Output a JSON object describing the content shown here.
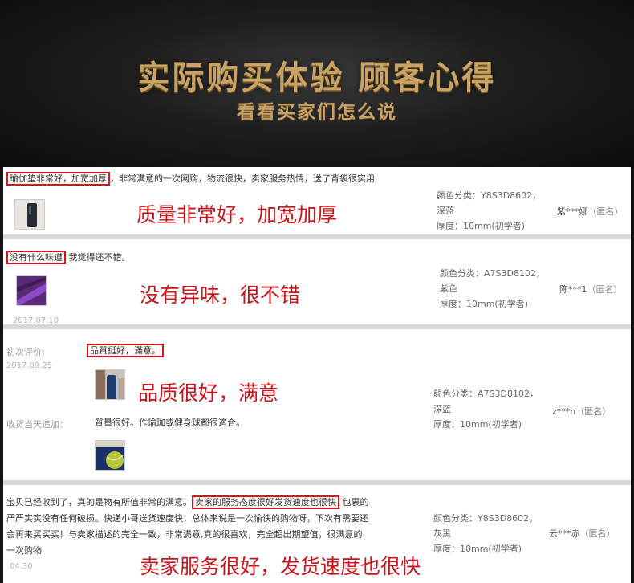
{
  "banner": {
    "title": "实际购买体验 顾客心得",
    "subtitle": "看看买家们怎么说"
  },
  "reviews": [
    {
      "highlight": "瑜伽垫非常好，加宽加厚",
      "rest": "，非常满意的一次网购，物流很快，卖家服务热情，送了背袋很实用",
      "caption": "质量非常好，加宽加厚",
      "meta1": "颜色分类：Y8S3D8602，",
      "meta2": "深蓝",
      "meta3": "厚度：10mm(初学者)",
      "user": "紫***娜",
      "anon": "（匿名）"
    },
    {
      "highlight": "没有什么味道",
      "rest": "我觉得还不错。",
      "caption": "没有异味，很不错",
      "date": "2017.07.10",
      "meta1": "颜色分类：A7S3D8102，",
      "meta2": "紫色",
      "meta3": "厚度：10mm(初学者)",
      "user": "陈***1",
      "anon": "（匿名）"
    },
    {
      "first_label": "初次评价:",
      "first_date": "2017.09.25",
      "highlight": "品質挺好，滿意。",
      "caption": "品质很好，满意",
      "followup_label": "收货当天追加：",
      "followup_text": "質量很好。作瑜珈或健身球都很適合。",
      "meta1": "颜色分类：A7S3D8102，",
      "meta2": "深蓝",
      "meta3": "厚度：10mm(初学者)",
      "user": "z***n",
      "anon": "（匿名）"
    },
    {
      "line1_pre": "宝贝已经收到了，真的是物有所值非常的满意。",
      "highlight": "卖家的服务态度很好发货速度也很快",
      "line1_post": "包裹的",
      "line2": "严严实实没有任何破损。快递小哥送货速度快，总体来说是一次愉快的购物呀，下次有需要还",
      "line3": "会再来买买买！与卖家描述的完全一致，非常满意,真的很喜欢，完全超出期望值，很满意的",
      "line4": "一次购物",
      "date": "04.30",
      "caption": "卖家服务很好，发货速度也很快",
      "meta1": "颜色分类：Y8S3D8602，",
      "meta2": "灰黑",
      "meta3": "厚度：10mm(初学者)",
      "user": "云***赤",
      "anon": "（匿名）"
    }
  ],
  "colors": {
    "gold": "#c9a265",
    "highlight_red": "#d8141a",
    "caption_red": "#c8141a"
  }
}
